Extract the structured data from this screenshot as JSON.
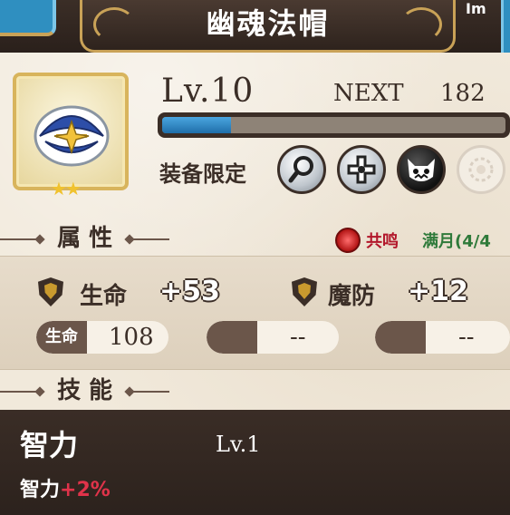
{
  "header": {
    "title": "幽魂法帽",
    "top_right_tag": "Im"
  },
  "item": {
    "icon": "blue-cap-icon",
    "stars": "★★",
    "rarity_color": "#f0c22e"
  },
  "level": {
    "current": "Lv.10",
    "next_label": "NEXT",
    "next_value": "182",
    "progress": 0.2
  },
  "equip": {
    "label": "装备限定",
    "class_icons": [
      "magnifier-class-icon",
      "cross-class-icon",
      "demon-class-icon",
      "faded-class-icon"
    ]
  },
  "attributes": {
    "header": "属 性",
    "resonance_label": "共鸣",
    "resonance_status": "满月(4/4",
    "stats": [
      {
        "label": "生命",
        "value": "+53"
      },
      {
        "label": "魔防",
        "value": "+12"
      }
    ],
    "sub_stats": [
      {
        "tag": "生命",
        "value": "108"
      },
      {
        "tag": "",
        "value": "--"
      },
      {
        "tag": "",
        "value": "--"
      }
    ]
  },
  "skills": {
    "header": "技 能",
    "name": "智力",
    "level": "Lv.1",
    "desc_stat": "智力",
    "desc_bonus": "+2%"
  },
  "colors": {
    "accent_gold": "#c9a257",
    "xp_blue": "#1f6ea9",
    "dark_brown": "#3b2e27",
    "bonus_red": "#e0334a",
    "resonance_green": "#2f7a3a"
  }
}
